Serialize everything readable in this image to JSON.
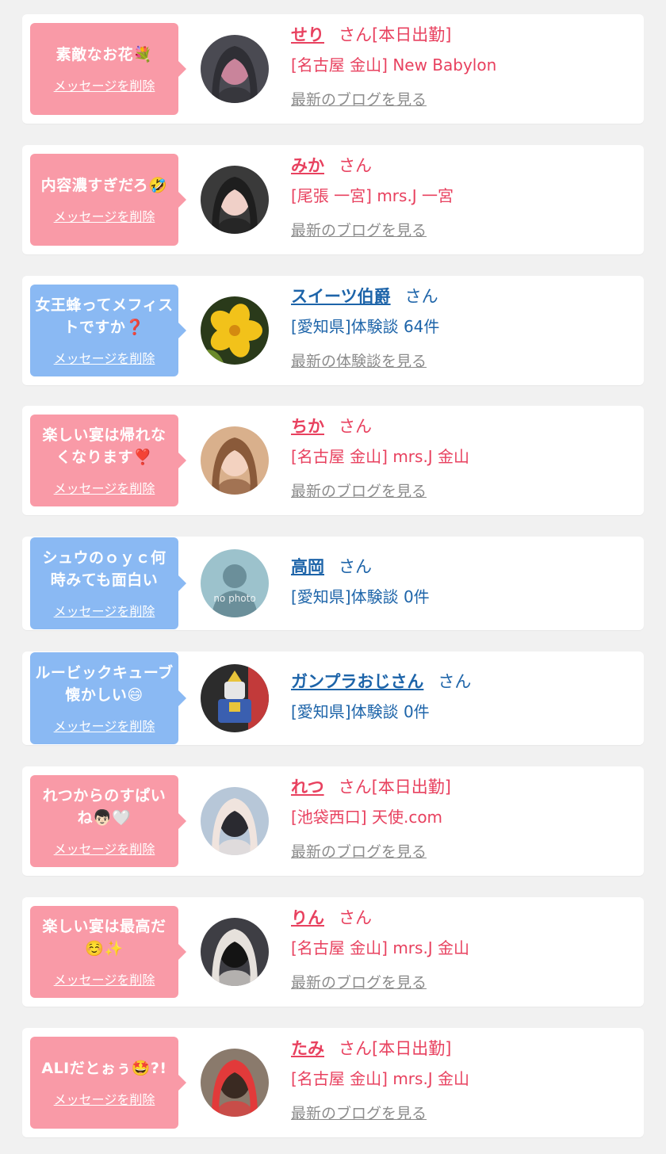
{
  "colors": {
    "pink_bubble": "#f99aa7",
    "blue_bubble": "#8ab9f3",
    "pink_text": "#e8415f",
    "blue_text": "#1d64a9",
    "link_gray": "#8c8c8c",
    "background": "#f1f1f1"
  },
  "items": [
    {
      "bubble_color": "pink",
      "message": "素敵なお花💐",
      "delete_label": "メッセージを削除",
      "name": "せり",
      "honorific": "さん[本日出勤]",
      "shop": "[名古屋 金山] New Babylon",
      "link_label": "最新のブログを見る",
      "avatar_icon": "girl-photo"
    },
    {
      "bubble_color": "pink",
      "message": "内容濃すぎだろ🤣",
      "delete_label": "メッセージを削除",
      "name": "みか",
      "honorific": "さん",
      "shop": "[尾張 一宮] mrs.J 一宮",
      "link_label": "最新のブログを見る",
      "avatar_icon": "girl-photo"
    },
    {
      "bubble_color": "blue",
      "message": "女王蜂ってメフィストですか❓",
      "delete_label": "メッセージを削除",
      "name": "スイーツ伯爵",
      "honorific": "さん",
      "shop": "[愛知県]体験談 64件",
      "link_label": "最新の体験談を見る",
      "avatar_icon": "flower-photo"
    },
    {
      "bubble_color": "pink",
      "message": "楽しい宴は帰れなくなります❣️",
      "delete_label": "メッセージを削除",
      "name": "ちか",
      "honorific": "さん",
      "shop": "[名古屋 金山] mrs.J 金山",
      "link_label": "最新のブログを見る",
      "avatar_icon": "girl-photo"
    },
    {
      "bubble_color": "blue",
      "message": "シュウのｏｙｃ何時みても面白い",
      "delete_label": "メッセージを削除",
      "name": "高岡",
      "honorific": "さん",
      "shop": "[愛知県]体験談 0件",
      "link_label": "",
      "avatar_icon": "no-photo",
      "avatar_text": "no photo"
    },
    {
      "bubble_color": "blue",
      "message": "ルービックキューブ懐かしい😄",
      "delete_label": "メッセージを削除",
      "name": "ガンプラおじさん",
      "honorific": "さん",
      "shop": "[愛知県]体験談 0件",
      "link_label": "",
      "avatar_icon": "robot-photo"
    },
    {
      "bubble_color": "pink",
      "message": "れつからのすぱいね👦🏻🤍",
      "delete_label": "メッセージを削除",
      "name": "れつ",
      "honorific": "さん[本日出勤]",
      "shop": "[池袋西口] 天使.com",
      "link_label": "最新のブログを見る",
      "avatar_icon": "girl-photo"
    },
    {
      "bubble_color": "pink",
      "message": "楽しい宴は最高だ☺️✨",
      "delete_label": "メッセージを削除",
      "name": "りん",
      "honorific": "さん",
      "shop": "[名古屋 金山] mrs.J 金山",
      "link_label": "最新のブログを見る",
      "avatar_icon": "girl-photo"
    },
    {
      "bubble_color": "pink",
      "message": "ALIだとぉぅ🤩?!",
      "delete_label": "メッセージを削除",
      "name": "たみ",
      "honorific": "さん[本日出勤]",
      "shop": "[名古屋 金山] mrs.J 金山",
      "link_label": "最新のブログを見る",
      "avatar_icon": "girl-photo"
    }
  ]
}
